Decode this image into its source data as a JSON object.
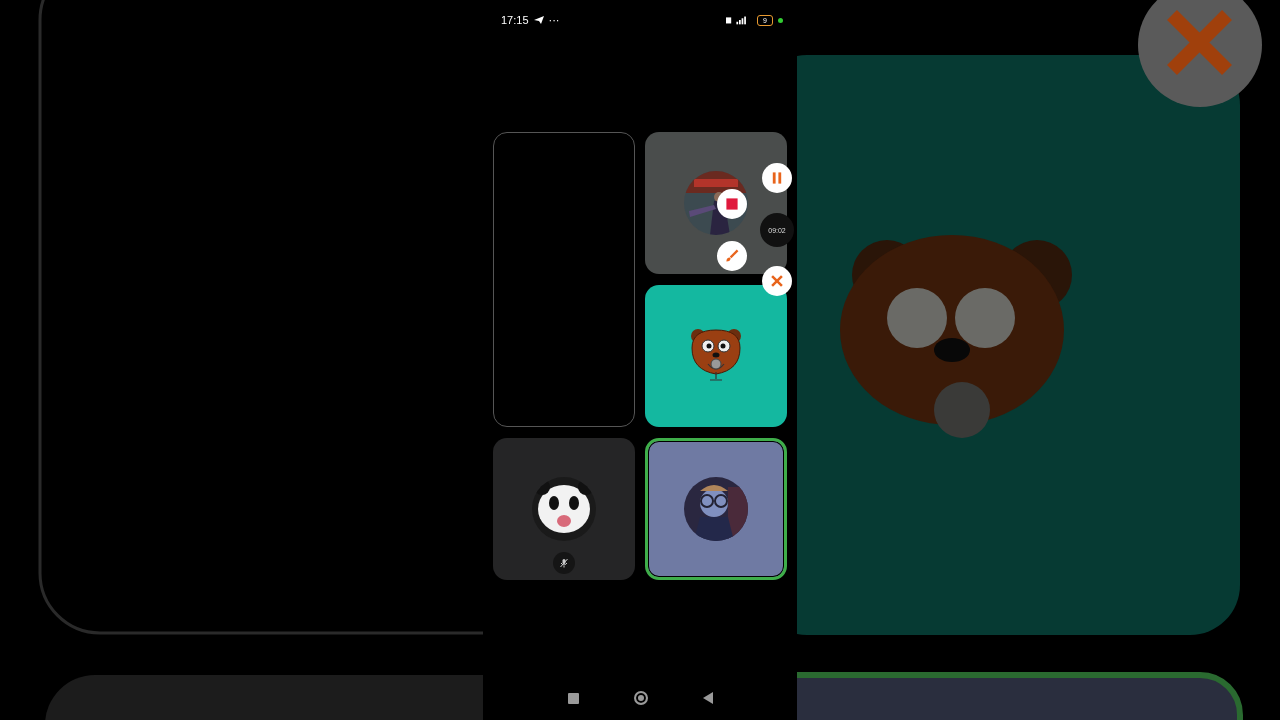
{
  "status_bar": {
    "time": "17:15",
    "more": "···",
    "battery": "9"
  },
  "tiles": [
    {
      "kind": "empty",
      "color": "#000000",
      "speaking": false,
      "muted": false
    },
    {
      "kind": "avatar",
      "color": "#4a4d4c",
      "speaking": false,
      "muted": false
    },
    {
      "kind": "bear",
      "color": "#14b8a0",
      "speaking": false,
      "muted": false
    },
    {
      "kind": "panda",
      "color": "#252526",
      "speaking": false,
      "muted": true
    },
    {
      "kind": "person",
      "color": "#6f7aa3",
      "speaking": true,
      "muted": false
    }
  ],
  "recording": {
    "timer": "09:02"
  }
}
